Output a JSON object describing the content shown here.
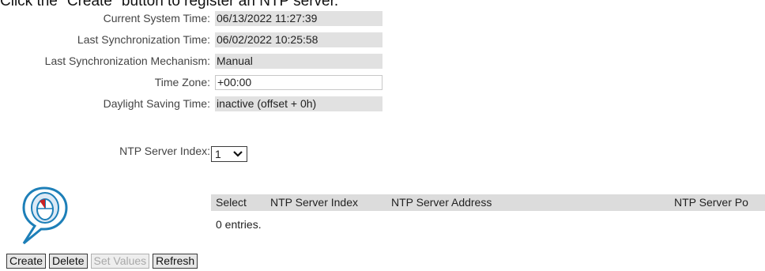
{
  "instruction": "Click the \"Create\" button to register an NTP server.",
  "fields": [
    {
      "label": "Current System Time",
      "value": "06/13/2022 11:27:39"
    },
    {
      "label": "Last Synchronization Time",
      "value": "06/02/2022 10:25:58"
    },
    {
      "label": "Last Synchronization Mechanism",
      "value": "Manual"
    },
    {
      "label": "Time Zone",
      "value": "+00:00"
    },
    {
      "label": "Daylight Saving Time",
      "value": "inactive (offset + 0h)"
    }
  ],
  "ntp_index": {
    "label": "NTP Server Index",
    "selected": "1"
  },
  "table": {
    "columns": [
      "Select",
      "NTP Server Index",
      "NTP Server Address",
      "NTP Server Po"
    ],
    "entries_text": "0 entries."
  },
  "buttons": {
    "create": "Create",
    "delete": "Delete",
    "set_values": "Set Values",
    "refresh": "Refresh"
  },
  "icons": {
    "help_bubble": "mouse-hint-icon",
    "dropdown": "chevron-down-icon"
  },
  "colors": {
    "field_bg": "#e1e1e1",
    "header_bg": "#dcdcdc",
    "hint_blue": "#1d7fb8"
  }
}
